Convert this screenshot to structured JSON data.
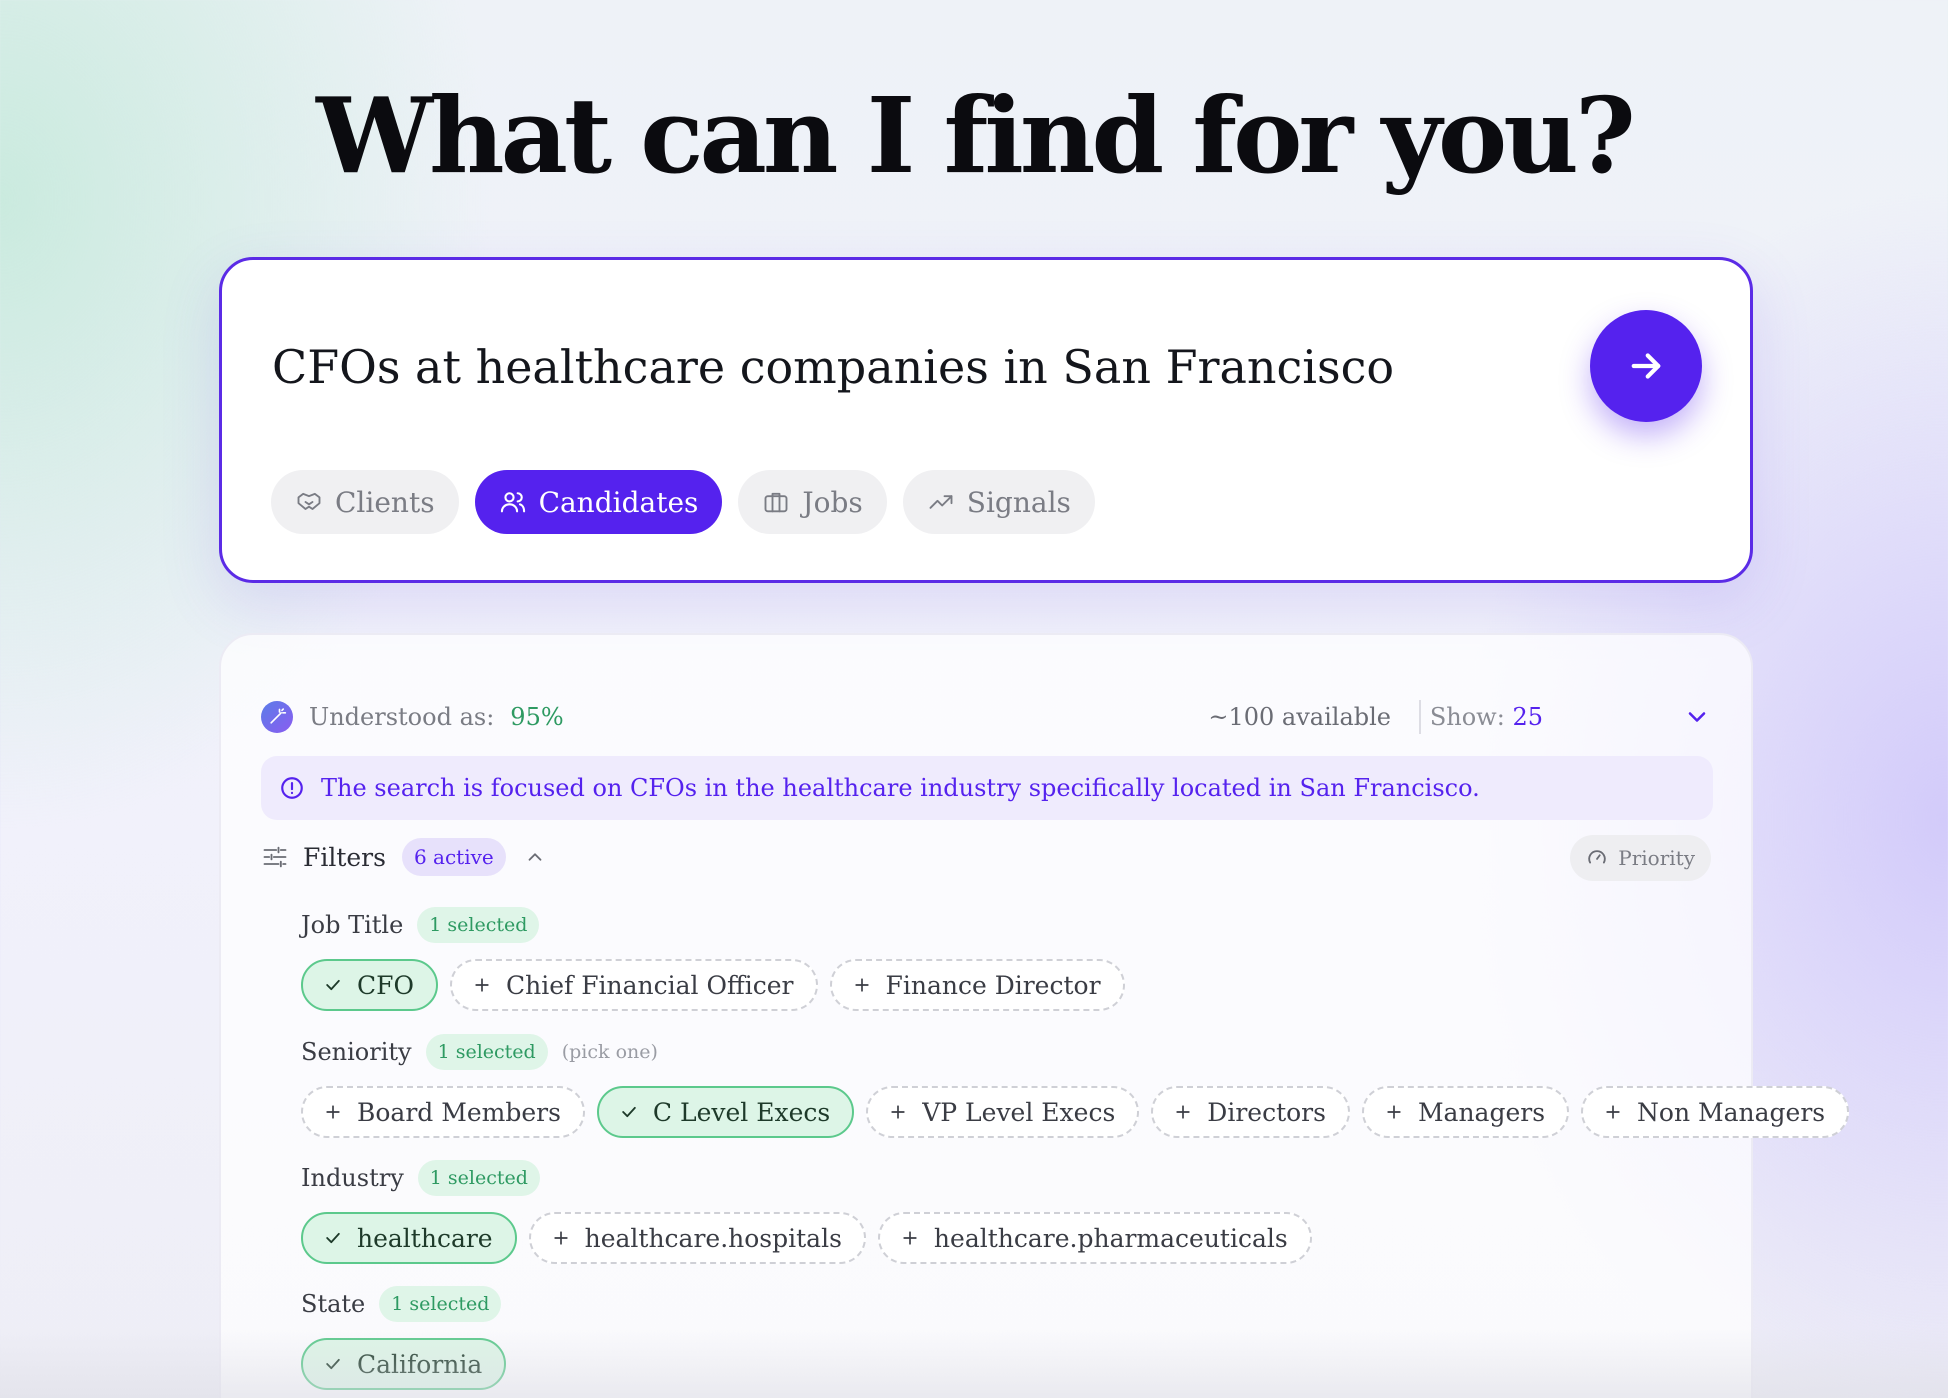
{
  "hero": {
    "title": "What can I find for you?"
  },
  "search": {
    "query": "CFOs at healthcare companies in San Francisco",
    "submit_icon": "arrow-right-icon",
    "tabs": [
      {
        "label": "Clients",
        "icon": "handshake-icon",
        "active": false
      },
      {
        "label": "Candidates",
        "icon": "users-icon",
        "active": true
      },
      {
        "label": "Jobs",
        "icon": "briefcase-icon",
        "active": false
      },
      {
        "label": "Signals",
        "icon": "trending-up-icon",
        "active": false
      }
    ]
  },
  "results": {
    "understood_label": "Understood as:",
    "understood_pct": "95%",
    "available": "~100 available",
    "show_label": "Show:",
    "show_value": "25",
    "info": "The search is focused on CFOs in the healthcare industry specifically located in San Francisco.",
    "filters_label": "Filters",
    "active_count": "6 active",
    "priority_label": "Priority",
    "groups": [
      {
        "title": "Job Title",
        "badge": "1 selected",
        "note": "",
        "chips": [
          {
            "label": "CFO",
            "selected": true
          },
          {
            "label": "Chief Financial Officer",
            "selected": false
          },
          {
            "label": "Finance Director",
            "selected": false
          }
        ]
      },
      {
        "title": "Seniority",
        "badge": "1 selected",
        "note": "(pick one)",
        "chips": [
          {
            "label": "Board Members",
            "selected": false
          },
          {
            "label": "C Level Execs",
            "selected": true
          },
          {
            "label": "VP Level Execs",
            "selected": false
          },
          {
            "label": "Directors",
            "selected": false
          },
          {
            "label": "Managers",
            "selected": false
          },
          {
            "label": "Non Managers",
            "selected": false
          }
        ]
      },
      {
        "title": "Industry",
        "badge": "1 selected",
        "note": "",
        "chips": [
          {
            "label": "healthcare",
            "selected": true
          },
          {
            "label": "healthcare.hospitals",
            "selected": false
          },
          {
            "label": "healthcare.pharmaceuticals",
            "selected": false
          }
        ]
      },
      {
        "title": "State",
        "badge": "1 selected",
        "note": "",
        "chips": [
          {
            "label": "California",
            "selected": true
          }
        ]
      }
    ]
  },
  "colors": {
    "accent": "#5522EE",
    "selected_bg": "#DDF5E7",
    "selected_border": "#5CC98C",
    "success_text": "#2E9A62"
  }
}
